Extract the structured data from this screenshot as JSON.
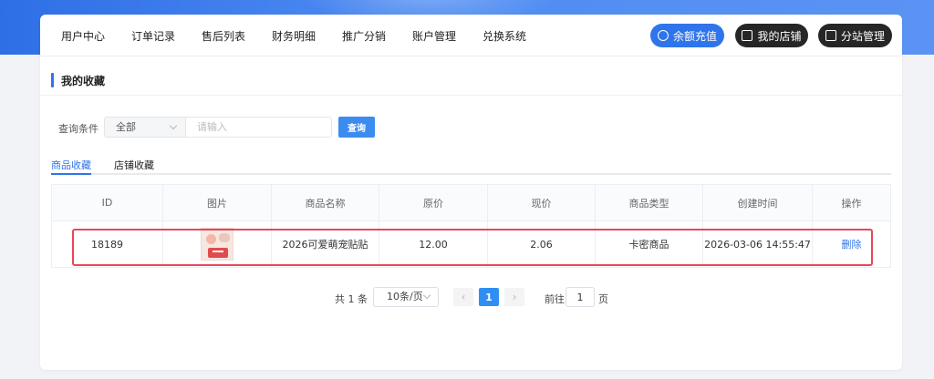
{
  "nav": {
    "items": [
      "用户中心",
      "订单记录",
      "售后列表",
      "财务明细",
      "推广分销",
      "账户管理",
      "兑换系统"
    ],
    "buttons": {
      "recharge": "余额充值",
      "my_shop": "我的店铺",
      "substation": "分站管理"
    }
  },
  "section": {
    "title": "我的收藏"
  },
  "query": {
    "label": "查询条件",
    "select_value": "全部",
    "input_placeholder": "请输入",
    "button": "查询"
  },
  "tabs": [
    "商品收藏",
    "店铺收藏"
  ],
  "table": {
    "headers": [
      "ID",
      "图片",
      "商品名称",
      "原价",
      "现价",
      "商品类型",
      "创建时间",
      "操作"
    ],
    "rows": [
      {
        "id": "18189",
        "name": "2026可爱萌宠贴贴",
        "original_price": "12.00",
        "current_price": "2.06",
        "type": "卡密商品",
        "created": "2026-03-06 14:55:47",
        "action": "删除"
      }
    ]
  },
  "pagination": {
    "total": "共 1 条",
    "page_size": "10条/页",
    "current_page": "1",
    "goto_label": "前往",
    "goto_value": "1",
    "page_suffix": "页",
    "prev": "‹",
    "next": "›"
  },
  "colors": {
    "accent": "#2f74ea",
    "dark_button": "#262626",
    "highlight": "#e8475c",
    "page_bg": "#f2f3f6"
  },
  "icons": {
    "recharge": "wallet-icon",
    "my_shop": "shop-icon",
    "substation": "monitor-icon"
  }
}
